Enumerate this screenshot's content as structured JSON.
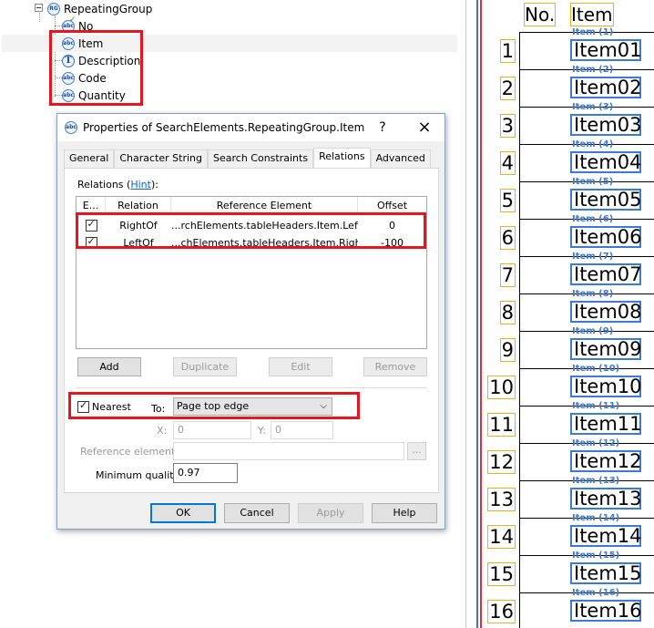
{
  "tree": {
    "root_label": "RepeatingGroup",
    "items": [
      "No",
      "Item",
      "Description",
      "Code",
      "Quantity"
    ]
  },
  "dialog": {
    "title": "Properties of SearchElements.RepeatingGroup.Item",
    "help_glyph": "?",
    "close_glyph": "×",
    "tabs": [
      "General",
      "Character String",
      "Search Constraints",
      "Relations",
      "Advanced"
    ],
    "active_tab": "Relations",
    "relations_label": "Relations (",
    "hint_link": "Hint",
    "relations_label_end": "):",
    "columns": [
      "E...",
      "Relation",
      "Reference Element",
      "Offset"
    ],
    "rows": [
      {
        "enabled": true,
        "relation": "RightOf",
        "reference": "...rchElements.tableHeaders.Item.Left",
        "offset": "0"
      },
      {
        "enabled": true,
        "relation": "LeftOf",
        "reference": "...chElements.tableHeaders.Item.Right",
        "offset": "-100"
      }
    ],
    "buttons": {
      "add": "Add",
      "duplicate": "Duplicate",
      "edit": "Edit",
      "remove": "Remove"
    },
    "nearest_label": "Nearest",
    "to_label": "To:",
    "to_value": "Page top edge",
    "x_label": "X:",
    "x_value": "0",
    "y_label": "Y:",
    "y_value": "0",
    "ref_element_label": "Reference element:",
    "browse_label": "...",
    "min_quality_label": "Minimum quality:",
    "min_quality_value": "0.97",
    "footer": {
      "ok": "OK",
      "cancel": "Cancel",
      "apply": "Apply",
      "help": "Help"
    }
  },
  "document": {
    "headers": [
      "No.",
      "Item"
    ],
    "rows": [
      {
        "no": "1",
        "caption": "Item (1)",
        "item": "Item01"
      },
      {
        "no": "2",
        "caption": "Item (2)",
        "item": "Item02"
      },
      {
        "no": "3",
        "caption": "Item (3)",
        "item": "Item03"
      },
      {
        "no": "4",
        "caption": "Item (4)",
        "item": "Item04"
      },
      {
        "no": "5",
        "caption": "Item (5)",
        "item": "Item05"
      },
      {
        "no": "6",
        "caption": "Item (6)",
        "item": "Item06"
      },
      {
        "no": "7",
        "caption": "Item (7)",
        "item": "Item07"
      },
      {
        "no": "8",
        "caption": "Item (8)",
        "item": "Item08"
      },
      {
        "no": "9",
        "caption": "Item (9)",
        "item": "Item09"
      },
      {
        "no": "10",
        "caption": "Item (10)",
        "item": "Item10"
      },
      {
        "no": "11",
        "caption": "Item (11)",
        "item": "Item11"
      },
      {
        "no": "12",
        "caption": "Item (12)",
        "item": "Item12"
      },
      {
        "no": "13",
        "caption": "Item (13)",
        "item": "Item13"
      },
      {
        "no": "14",
        "caption": "Item (14)",
        "item": "Item14"
      },
      {
        "no": "15",
        "caption": "Item (15)",
        "item": "Item15"
      },
      {
        "no": "16",
        "caption": "Item (16)",
        "item": "Item16"
      }
    ]
  },
  "colors": {
    "highlight_red": "#e8141f",
    "match_blue": "#3a7bd5",
    "header_yellow": "#e6b31e"
  }
}
